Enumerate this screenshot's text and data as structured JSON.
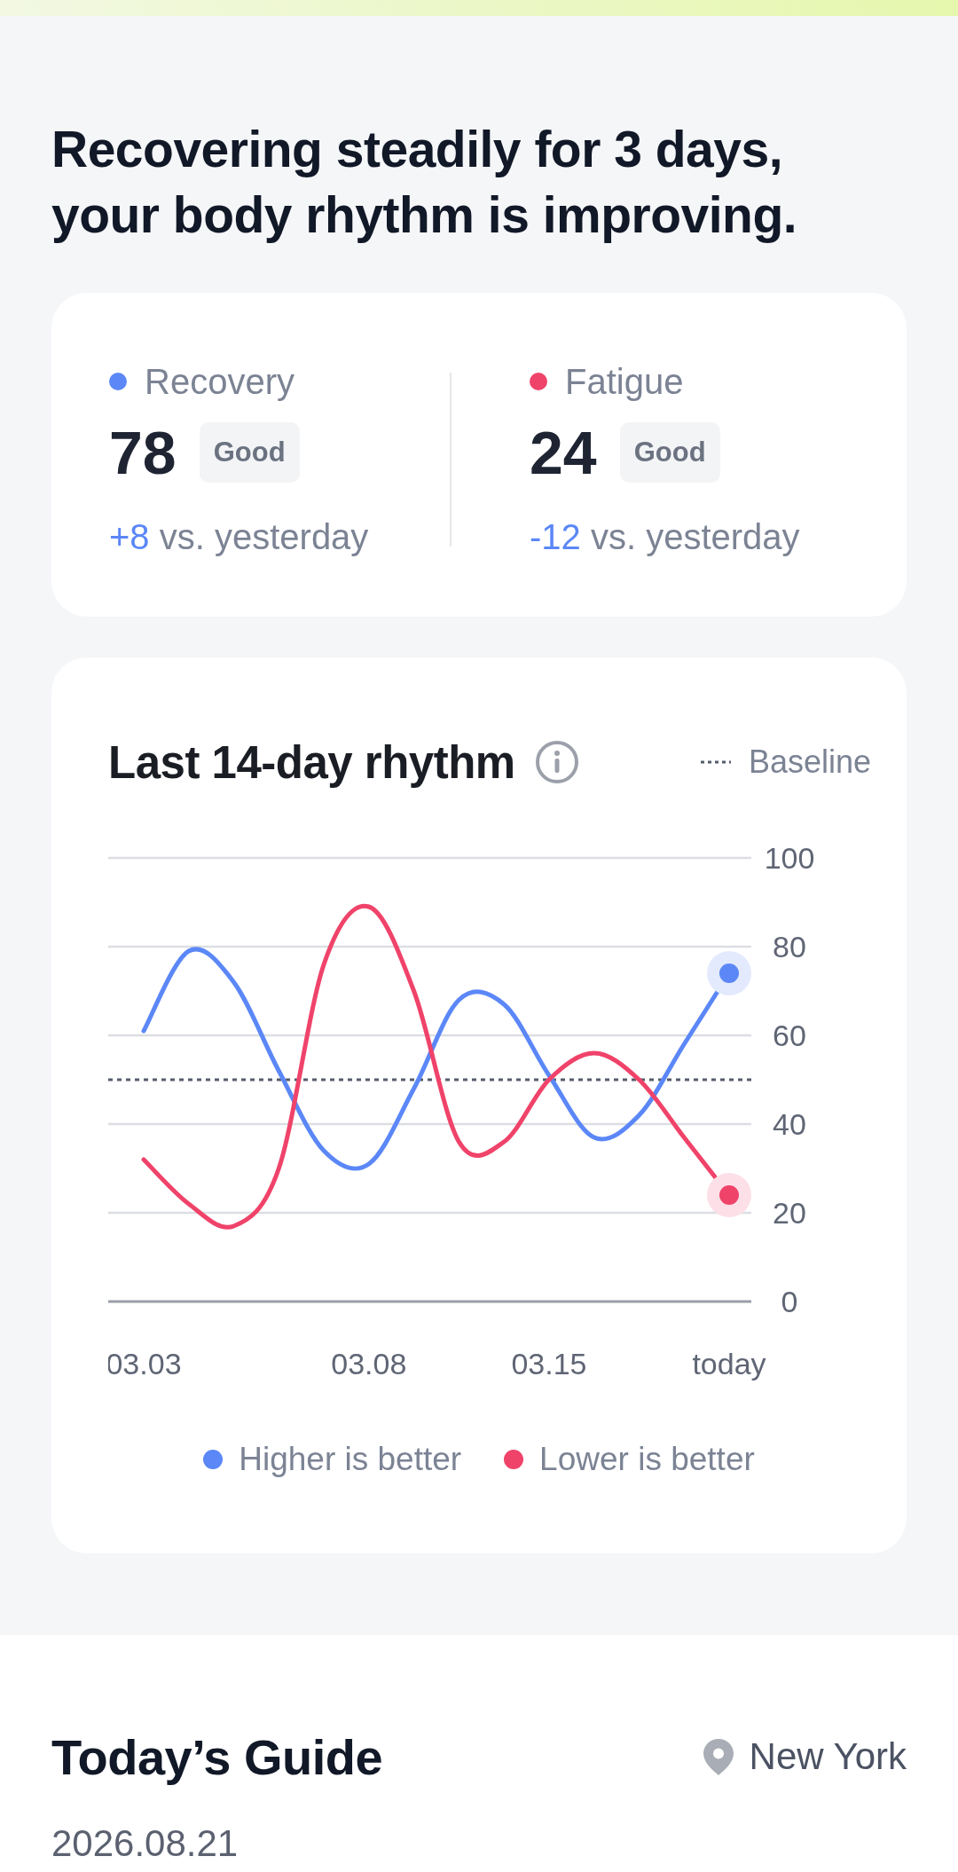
{
  "headline": "Recovering steadily for 3 days,\nyour body rhythm is improving.",
  "metrics": [
    {
      "label": "Recovery",
      "color": "#5b87f7",
      "value": "78",
      "badge": "Good",
      "delta": "+8",
      "comparison": "vs. yesterday"
    },
    {
      "label": "Fatigue",
      "color": "#f0436a",
      "value": "24",
      "badge": "Good",
      "delta": "-12",
      "comparison": "vs. yesterday"
    }
  ],
  "chart_card": {
    "chart_data": {
      "type": "line",
      "title": "Last 14-day rhythm",
      "categories": [
        "03.03",
        null,
        null,
        null,
        null,
        "03.08",
        null,
        null,
        null,
        "03.15",
        null,
        null,
        null,
        "today"
      ],
      "series": [
        {
          "name": "Higher is better",
          "color": "#5b87f7",
          "values": [
            61,
            79,
            72,
            52,
            34,
            31,
            48,
            68,
            67,
            51,
            37,
            42,
            58,
            74
          ]
        },
        {
          "name": "Lower is better",
          "color": "#f0436a",
          "values": [
            32,
            22,
            17,
            30,
            76,
            89,
            70,
            36,
            36,
            50,
            56,
            50,
            37,
            24
          ]
        }
      ],
      "ylim": [
        0,
        100
      ],
      "yticks": [
        0,
        20,
        40,
        60,
        80,
        100
      ],
      "grid": true,
      "ref_lines": [
        {
          "axis": "y",
          "value": 50,
          "label": "Baseline"
        }
      ]
    }
  },
  "guide": {
    "title": "Today’s Guide",
    "location": "New York",
    "date": "2026.08.21"
  }
}
